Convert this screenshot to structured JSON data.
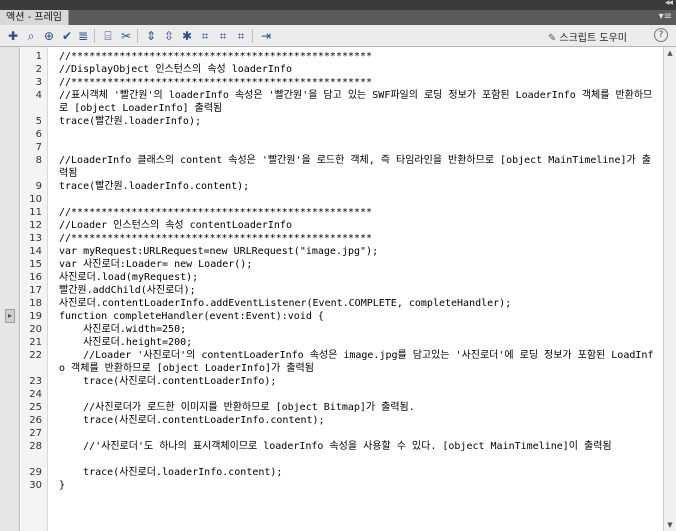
{
  "panel": {
    "tab_label": "액션 - 프레임"
  },
  "toolbar": {
    "script_assist_label": "스크립트 도우미"
  },
  "code_lines": [
    {
      "n": "1",
      "t": "//**************************************************",
      "cls": "c-comment"
    },
    {
      "n": "2",
      "t": "//DisplayObject 인스턴스의 속성 loaderInfo",
      "cls": "c-comment"
    },
    {
      "n": "3",
      "t": "//**************************************************",
      "cls": "c-comment"
    },
    {
      "n": "4",
      "t": "//표시객체 '빨간원'의 loaderInfo 속성은 '빨간원'을 담고 있는 SWF파일의 로딩 정보가 포함된 LoaderInfo 객체를 반환하므로 [object LoaderInfo] 출력됨",
      "cls": "c-comment",
      "wrap": true
    },
    {
      "n": "5",
      "t": "trace(빨간원.loaderInfo);",
      "cls": ""
    },
    {
      "n": "6",
      "t": "",
      "cls": ""
    },
    {
      "n": "7",
      "t": "",
      "cls": ""
    },
    {
      "n": "8",
      "t": "//LoaderInfo 클래스의 content 속성은 '빨간원'을 로드한 객체, 즉 타임라인을 반환하므로 [object MainTimeline]가 출력됨",
      "cls": "c-comment",
      "wrap": true
    },
    {
      "n": "9",
      "t": "trace(빨간원.loaderInfo.content);",
      "cls": ""
    },
    {
      "n": "10",
      "t": "",
      "cls": ""
    },
    {
      "n": "11",
      "t": "//**************************************************",
      "cls": "c-comment"
    },
    {
      "n": "12",
      "t": "//Loader 인스턴스의 속성 contentLoaderInfo",
      "cls": "c-comment"
    },
    {
      "n": "13",
      "t": "//**************************************************",
      "cls": "c-comment"
    },
    {
      "n": "14",
      "t": "var myRequest:URLRequest=new URLRequest(\"image.jpg\");",
      "cls": ""
    },
    {
      "n": "15",
      "t": "var 사진로더:Loader= new Loader();",
      "cls": ""
    },
    {
      "n": "16",
      "t": "사진로더.load(myRequest);",
      "cls": ""
    },
    {
      "n": "17",
      "t": "빨간원.addChild(사진로더);",
      "cls": ""
    },
    {
      "n": "18",
      "t": "사진로더.contentLoaderInfo.addEventListener(Event.COMPLETE, completeHandler);",
      "cls": ""
    },
    {
      "n": "19",
      "t": "function completeHandler(event:Event):void {",
      "cls": ""
    },
    {
      "n": "20",
      "t": "    사진로더.width=250;",
      "cls": ""
    },
    {
      "n": "21",
      "t": "    사진로더.height=200;",
      "cls": ""
    },
    {
      "n": "22",
      "t": "    //Loader '사진로더'의 contentLoaderInfo 속성은 image.jpg를 담고있는 '사진로더'에 로딩 정보가 포함된 LoadInfo 객체를 반환하므로 [object LoaderInfo]가 출력됨",
      "cls": "c-comment",
      "wrap": true
    },
    {
      "n": "23",
      "t": "    trace(사진로더.contentLoaderInfo);",
      "cls": ""
    },
    {
      "n": "24",
      "t": "",
      "cls": ""
    },
    {
      "n": "25",
      "t": "    //사진로더가 로드한 이미지를 반환하므로 [object Bitmap]가 출력됨.",
      "cls": "c-comment"
    },
    {
      "n": "26",
      "t": "    trace(사진로더.contentLoaderInfo.content);",
      "cls": ""
    },
    {
      "n": "27",
      "t": "",
      "cls": ""
    },
    {
      "n": "28",
      "t": "    //'사진로더'도 하나의 표시객체이므로 loaderInfo 속성을 사용할 수 있다. [object MainTimeline]이 출력됨",
      "cls": "c-comment",
      "wrap": true
    },
    {
      "n": "29",
      "t": "    trace(사진로더.loaderInfo.content);",
      "cls": ""
    },
    {
      "n": "30",
      "t": "}",
      "cls": ""
    }
  ]
}
